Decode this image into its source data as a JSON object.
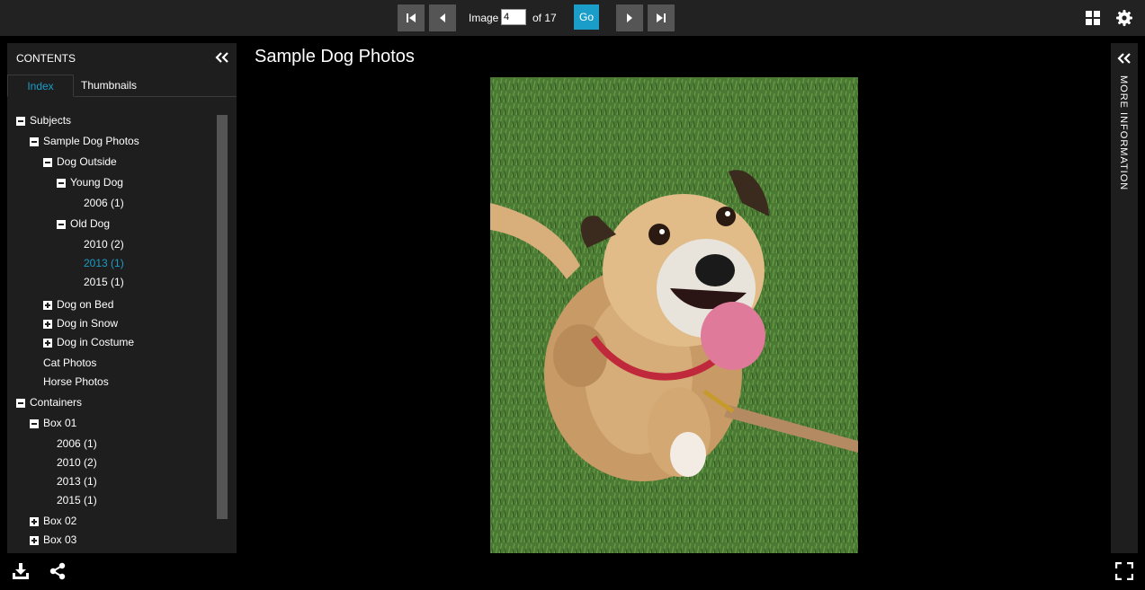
{
  "toolbar": {
    "image_label": "Image",
    "image_value": "4",
    "of_label": "of 17",
    "go_label": "Go",
    "icons": [
      "first-page-icon",
      "prev-page-icon",
      "next-page-icon",
      "last-page-icon",
      "grid-view-icon",
      "settings-icon"
    ]
  },
  "left_panel": {
    "header": "CONTENTS",
    "tabs": [
      "Index",
      "Thumbnails"
    ],
    "tree": [
      {
        "label": "Subjects",
        "toggle": "minus"
      },
      {
        "label": "Sample Dog Photos",
        "toggle": "minus"
      },
      {
        "label": "Dog Outside",
        "toggle": "minus"
      },
      {
        "label": "Young Dog",
        "toggle": "minus"
      },
      {
        "label": "2006 (1)",
        "toggle": "none"
      },
      {
        "label": "Old Dog",
        "toggle": "minus"
      },
      {
        "label": "2010 (2)",
        "toggle": "none"
      },
      {
        "label": "2013 (1)",
        "toggle": "none",
        "selected": true
      },
      {
        "label": "2015 (1)",
        "toggle": "none"
      },
      {
        "label": "Dog on Bed",
        "toggle": "plus"
      },
      {
        "label": "Dog in Snow",
        "toggle": "plus"
      },
      {
        "label": "Dog in Costume",
        "toggle": "plus"
      },
      {
        "label": "Cat Photos",
        "toggle": "none"
      },
      {
        "label": "Horse Photos",
        "toggle": "none"
      },
      {
        "label": "Containers",
        "toggle": "minus"
      },
      {
        "label": "Box 01",
        "toggle": "minus"
      },
      {
        "label": "2006 (1)",
        "toggle": "none"
      },
      {
        "label": "2010 (2)",
        "toggle": "none"
      },
      {
        "label": "2013 (1)",
        "toggle": "none"
      },
      {
        "label": "2015 (1)",
        "toggle": "none"
      },
      {
        "label": "Box 02",
        "toggle": "plus"
      },
      {
        "label": "Box 03",
        "toggle": "plus"
      }
    ]
  },
  "main": {
    "title": "Sample Dog Photos"
  },
  "right_panel": {
    "label": "MORE INFORMATION"
  },
  "colors": {
    "accent": "#1a9dc9",
    "panel": "#1e1e1e",
    "topbar": "#222222"
  }
}
